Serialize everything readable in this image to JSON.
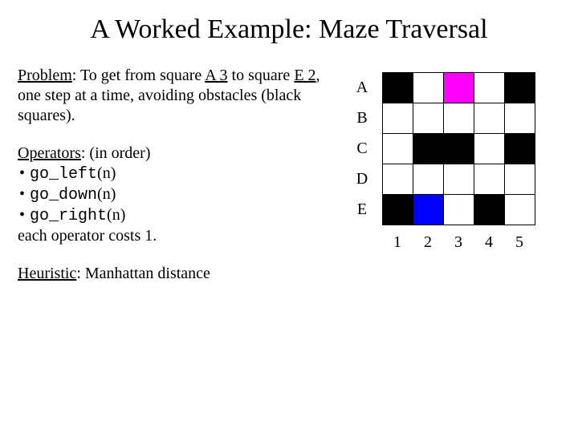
{
  "title": "A Worked Example: Maze Traversal",
  "problem": {
    "label": "Problem",
    "text1": ": To get from square ",
    "start": "A 3",
    "text2": " to square ",
    "goal": "E 2",
    "text3": ", one step at a time, avoiding obstacles (black squares)."
  },
  "operators": {
    "label": "Operators",
    "suffix": ": (in order)",
    "items": [
      {
        "fn": "go_left",
        "arg": "(n)"
      },
      {
        "fn": "go_down",
        "arg": "(n)"
      },
      {
        "fn": "go_right",
        "arg": "(n)"
      }
    ],
    "cost": "each operator costs 1."
  },
  "heuristic": {
    "label": "Heuristic",
    "text": ": Manhattan distance"
  },
  "maze": {
    "rows": [
      "A",
      "B",
      "C",
      "D",
      "E"
    ],
    "cols": [
      "1",
      "2",
      "3",
      "4",
      "5"
    ],
    "colors": {
      "empty": "#ffffff",
      "wall": "#000000",
      "start": "#ff00ff",
      "goal": "#0000ff"
    },
    "grid": [
      [
        "wall",
        "empty",
        "start",
        "empty",
        "wall"
      ],
      [
        "empty",
        "empty",
        "empty",
        "empty",
        "empty"
      ],
      [
        "empty",
        "wall",
        "wall",
        "empty",
        "wall"
      ],
      [
        "empty",
        "empty",
        "empty",
        "empty",
        "empty"
      ],
      [
        "wall",
        "goal",
        "empty",
        "wall",
        "empty"
      ]
    ]
  }
}
